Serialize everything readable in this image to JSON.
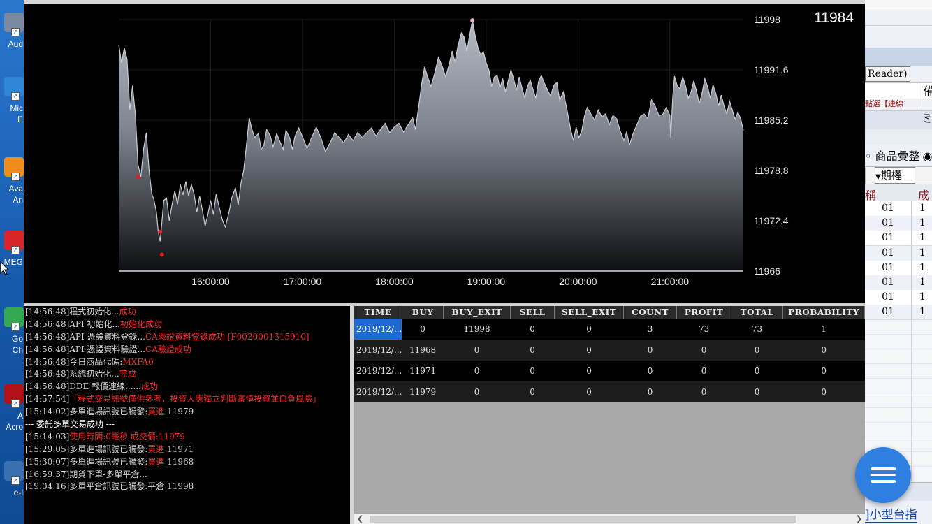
{
  "desktop": {
    "icons": [
      {
        "name": "audio-app",
        "label": "Aud",
        "color": "#7a8aa0"
      },
      {
        "name": "microsoft-edge",
        "label": "Mic",
        "label2": "E",
        "color": "#2d86d6"
      },
      {
        "name": "avast",
        "label": "Ava",
        "label2": "An",
        "color": "#f08c1e"
      },
      {
        "name": "mega",
        "label": "MEG",
        "color": "#d9242b"
      },
      {
        "name": "google-chrome",
        "label": "Go",
        "label2": "Ch",
        "color": "#34a853"
      },
      {
        "name": "adobe-acrobat",
        "label": "A",
        "label2": "Acro",
        "color": "#b3111a"
      },
      {
        "name": "e-app",
        "label": "e-l",
        "color": "#3a6fb0"
      }
    ]
  },
  "chart": {
    "current_price": "11984",
    "chart_data": {
      "type": "area",
      "x_ticks": [
        "16:00:00",
        "17:00:00",
        "18:00:00",
        "19:00:00",
        "20:00:00",
        "21:00:00"
      ],
      "y_ticks": [
        "11998",
        "11991.6",
        "11985.2",
        "11978.8",
        "11972.4",
        "11966"
      ],
      "ylim": [
        11966,
        11998
      ],
      "x_range_hours": [
        15.0,
        21.8
      ],
      "points": [
        [
          15.0,
          11994.8
        ],
        [
          15.03,
          11992.5
        ],
        [
          15.06,
          11994.4
        ],
        [
          15.09,
          11993.0
        ],
        [
          15.12,
          11986.5
        ],
        [
          15.15,
          11989.6
        ],
        [
          15.18,
          11986.0
        ],
        [
          15.21,
          11979.5
        ],
        [
          15.24,
          11978.0
        ],
        [
          15.27,
          11981.5
        ],
        [
          15.3,
          11983.6
        ],
        [
          15.33,
          11978.8
        ],
        [
          15.36,
          11975.8
        ],
        [
          15.38,
          11975.2
        ],
        [
          15.41,
          11973.5
        ],
        [
          15.43,
          11971.0
        ],
        [
          15.45,
          11969.8
        ],
        [
          15.47,
          11972.3
        ],
        [
          15.49,
          11975.0
        ],
        [
          15.52,
          11975.3
        ],
        [
          15.55,
          11972.4
        ],
        [
          15.58,
          11974.5
        ],
        [
          15.61,
          11976.2
        ],
        [
          15.64,
          11974.5
        ],
        [
          15.67,
          11977.0
        ],
        [
          15.7,
          11975.7
        ],
        [
          15.73,
          11977.4
        ],
        [
          15.76,
          11975.6
        ],
        [
          15.79,
          11977.0
        ],
        [
          15.82,
          11975.8
        ],
        [
          15.85,
          11973.5
        ],
        [
          15.88,
          11975.5
        ],
        [
          15.91,
          11973.8
        ],
        [
          15.94,
          11971.7
        ],
        [
          15.97,
          11973.2
        ],
        [
          16.0,
          11975.0
        ],
        [
          16.03,
          11973.2
        ],
        [
          16.06,
          11975.8
        ],
        [
          16.09,
          11974.3
        ],
        [
          16.13,
          11972.4
        ],
        [
          16.16,
          11971.6
        ],
        [
          16.2,
          11973.5
        ],
        [
          16.23,
          11975.3
        ],
        [
          16.27,
          11976.6
        ],
        [
          16.3,
          11974.4
        ],
        [
          16.33,
          11977.2
        ],
        [
          16.36,
          11978.8
        ],
        [
          16.39,
          11982.0
        ],
        [
          16.42,
          11985.5
        ],
        [
          16.45,
          11984.0
        ],
        [
          16.48,
          11983.0
        ],
        [
          16.52,
          11983.5
        ],
        [
          16.55,
          11981.5
        ],
        [
          16.58,
          11982.0
        ],
        [
          16.61,
          11984.0
        ],
        [
          16.65,
          11983.2
        ],
        [
          16.68,
          11981.8
        ],
        [
          16.72,
          11983.5
        ],
        [
          16.75,
          11982.6
        ],
        [
          16.79,
          11981.5
        ],
        [
          16.82,
          11983.9
        ],
        [
          16.86,
          11983.0
        ],
        [
          16.89,
          11981.5
        ],
        [
          16.92,
          11983.2
        ],
        [
          16.96,
          11984.2
        ],
        [
          17.0,
          11983.1
        ],
        [
          17.05,
          11981.6
        ],
        [
          17.1,
          11983.0
        ],
        [
          17.15,
          11984.3
        ],
        [
          17.2,
          11983.0
        ],
        [
          17.25,
          11981.2
        ],
        [
          17.3,
          11982.3
        ],
        [
          17.35,
          11983.6
        ],
        [
          17.4,
          11983.0
        ],
        [
          17.45,
          11982.3
        ],
        [
          17.5,
          11983.4
        ],
        [
          17.55,
          11982.6
        ],
        [
          17.6,
          11983.6
        ],
        [
          17.65,
          11983.0
        ],
        [
          17.7,
          11983.6
        ],
        [
          17.75,
          11984.2
        ],
        [
          17.8,
          11983.2
        ],
        [
          17.85,
          11984.0
        ],
        [
          17.9,
          11984.8
        ],
        [
          17.95,
          11983.6
        ],
        [
          18.0,
          11984.3
        ],
        [
          18.05,
          11984.8
        ],
        [
          18.1,
          11983.7
        ],
        [
          18.15,
          11984.6
        ],
        [
          18.2,
          11985.5
        ],
        [
          18.23,
          11984.0
        ],
        [
          18.26,
          11986.5
        ],
        [
          18.3,
          11990.0
        ],
        [
          18.33,
          11992.0
        ],
        [
          18.36,
          11990.8
        ],
        [
          18.4,
          11989.5
        ],
        [
          18.44,
          11991.2
        ],
        [
          18.48,
          11993.2
        ],
        [
          18.52,
          11992.1
        ],
        [
          18.56,
          11990.7
        ],
        [
          18.6,
          11992.4
        ],
        [
          18.63,
          11994.0
        ],
        [
          18.66,
          11992.6
        ],
        [
          18.69,
          11994.5
        ],
        [
          18.73,
          11996.3
        ],
        [
          18.76,
          11995.8
        ],
        [
          18.79,
          11994.0
        ],
        [
          18.82,
          11996.0
        ],
        [
          18.85,
          11997.9
        ],
        [
          18.88,
          11996.0
        ],
        [
          18.91,
          11994.5
        ],
        [
          18.94,
          11993.5
        ],
        [
          18.97,
          11993.9
        ],
        [
          19.0,
          11992.5
        ],
        [
          19.03,
          11991.6
        ],
        [
          19.06,
          11989.5
        ],
        [
          19.09,
          11990.7
        ],
        [
          19.12,
          11990.9
        ],
        [
          19.15,
          11989.3
        ],
        [
          19.18,
          11990.5
        ],
        [
          19.21,
          11988.8
        ],
        [
          19.24,
          11990.2
        ],
        [
          19.27,
          11991.6
        ],
        [
          19.3,
          11990.4
        ],
        [
          19.33,
          11989.0
        ],
        [
          19.36,
          11990.7
        ],
        [
          19.39,
          11989.3
        ],
        [
          19.42,
          11988.0
        ],
        [
          19.45,
          11989.5
        ],
        [
          19.48,
          11990.3
        ],
        [
          19.51,
          11989.1
        ],
        [
          19.54,
          11988.0
        ],
        [
          19.57,
          11990.1
        ],
        [
          19.6,
          11990.9
        ],
        [
          19.63,
          11990.0
        ],
        [
          19.67,
          11989.0
        ],
        [
          19.7,
          11988.3
        ],
        [
          19.74,
          11989.7
        ],
        [
          19.77,
          11990.0
        ],
        [
          19.8,
          11987.7
        ],
        [
          19.84,
          11988.8
        ],
        [
          19.88,
          11986.5
        ],
        [
          19.92,
          11984.0
        ],
        [
          19.95,
          11982.6
        ],
        [
          19.98,
          11984.3
        ],
        [
          20.01,
          11983.0
        ],
        [
          20.04,
          11983.8
        ],
        [
          20.07,
          11985.7
        ],
        [
          20.1,
          11986.8
        ],
        [
          20.14,
          11986.0
        ],
        [
          20.18,
          11985.2
        ],
        [
          20.22,
          11986.5
        ],
        [
          20.26,
          11985.6
        ],
        [
          20.3,
          11986.0
        ],
        [
          20.34,
          11984.6
        ],
        [
          20.38,
          11985.8
        ],
        [
          20.42,
          11985.4
        ],
        [
          20.46,
          11983.8
        ],
        [
          20.5,
          11982.6
        ],
        [
          20.53,
          11983.7
        ],
        [
          20.56,
          11982.0
        ],
        [
          20.6,
          11983.5
        ],
        [
          20.64,
          11984.6
        ],
        [
          20.68,
          11985.7
        ],
        [
          20.72,
          11986.0
        ],
        [
          20.76,
          11985.4
        ],
        [
          20.8,
          11987.8
        ],
        [
          20.84,
          11987.0
        ],
        [
          20.88,
          11985.8
        ],
        [
          20.92,
          11985.9
        ],
        [
          20.96,
          11986.8
        ],
        [
          21.0,
          11985.8
        ],
        [
          21.01,
          11983.0
        ],
        [
          21.03,
          11988.0
        ],
        [
          21.05,
          11990.8
        ],
        [
          21.08,
          11989.6
        ],
        [
          21.11,
          11989.2
        ],
        [
          21.14,
          11990.7
        ],
        [
          21.17,
          11989.6
        ],
        [
          21.2,
          11988.0
        ],
        [
          21.23,
          11988.8
        ],
        [
          21.26,
          11990.2
        ],
        [
          21.29,
          11988.9
        ],
        [
          21.32,
          11987.3
        ],
        [
          21.35,
          11988.6
        ],
        [
          21.38,
          11990.5
        ],
        [
          21.41,
          11989.5
        ],
        [
          21.44,
          11988.0
        ],
        [
          21.47,
          11989.7
        ],
        [
          21.5,
          11988.6
        ],
        [
          21.53,
          11987.0
        ],
        [
          21.56,
          11988.4
        ],
        [
          21.59,
          11987.0
        ],
        [
          21.62,
          11986.0
        ],
        [
          21.65,
          11987.6
        ],
        [
          21.68,
          11986.5
        ],
        [
          21.71,
          11985.3
        ],
        [
          21.74,
          11986.2
        ],
        [
          21.77,
          11985.4
        ],
        [
          21.8,
          11983.9
        ]
      ],
      "markers": [
        {
          "x": 15.21,
          "y": 11978.0,
          "color": "#e02020"
        },
        {
          "x": 15.45,
          "y": 11971.0,
          "color": "#e02020"
        },
        {
          "x": 15.47,
          "y": 11968.1,
          "color": "#e02020"
        },
        {
          "x": 18.85,
          "y": 11997.9,
          "color": "#f0b8c0"
        }
      ]
    }
  },
  "log": {
    "lines": [
      {
        "ts": "[14:56:48]",
        "text": "程式初始化...",
        "hl": "成功"
      },
      {
        "ts": "[14:56:48]",
        "text": "API 初始化...",
        "hl": "初始化成功"
      },
      {
        "ts": "[14:56:48]",
        "text": "API 憑證資料登錄...",
        "hl": "CA憑證資料登錄成功 [F0020001315910]"
      },
      {
        "ts": "[14:56:48]",
        "text": "API 憑證資料驗證...",
        "hl": "CA驗證成功"
      },
      {
        "ts": "[14:56:48]",
        "text": "今日商品代碼:",
        "hl": "MXFA0"
      },
      {
        "ts": "[14:56:48]",
        "text": "系統初始化...",
        "hl": "完成"
      },
      {
        "ts": "[14:56:48]",
        "text": "DDE 報價連線......",
        "hl": "成功"
      },
      {
        "ts": "[14:57:54]",
        "text": "",
        "hl": "「程式交易訊號僅供參考，投資人應獨立判斷審慎投資並自負風險」"
      },
      {
        "ts": "[15:14:02]",
        "text": "多單進場訊號已觸發:",
        "hl": "買進",
        "tail": " 11979"
      },
      {
        "ts": "",
        "text": "--- 委託多單交易成功 ---",
        "hl": ""
      },
      {
        "ts": "[15:14:03]",
        "text": "",
        "hl": "使用時間:0毫秒 成交價:11979"
      },
      {
        "ts": "[15:29:05]",
        "text": "多單進場訊號已觸發:",
        "hl": "買進",
        "tail": " 11971"
      },
      {
        "ts": "[15:30:07]",
        "text": "多單進場訊號已觸發:",
        "hl": "買進",
        "tail": " 11968"
      },
      {
        "ts": "[16:59:37]",
        "text": "期貨下單-多單平倉...",
        "hl": ""
      },
      {
        "ts": "[19:04:16]",
        "text": "多單平倉訊號已觸發:平倉 11998",
        "hl": ""
      }
    ]
  },
  "table": {
    "headers": [
      "TIME",
      "BUY",
      "BUY_EXIT",
      "SELL",
      "SELL_EXIT",
      "COUNT",
      "PROFIT",
      "TOTAL",
      "PROBABILITY"
    ],
    "rows": [
      [
        "2019/12/...",
        "0",
        "11998",
        "0",
        "0",
        "3",
        "73",
        "73",
        "1"
      ],
      [
        "2019/12/...",
        "11968",
        "0",
        "0",
        "0",
        "0",
        "0",
        "0",
        "0"
      ],
      [
        "2019/12/...",
        "11971",
        "0",
        "0",
        "0",
        "0",
        "0",
        "0",
        "0"
      ],
      [
        "2019/12/...",
        "11979",
        "0",
        "0",
        "0",
        "0",
        "0",
        "0",
        "0"
      ]
    ]
  },
  "right_window": {
    "reader_label": "Reader)",
    "header_char": "備",
    "menu_text": "點選【連線",
    "radio_label": "商品彙整",
    "dropdown_label": "期權",
    "col_name": "稱",
    "col_trade": "成",
    "row_values": [
      "01",
      "01",
      "01",
      "01",
      "01",
      "01",
      "01",
      "01"
    ],
    "row_trail": [
      "1",
      "1",
      "1",
      "1",
      "1",
      "1",
      "1",
      "1"
    ],
    "footer_label": "]小型台指"
  }
}
